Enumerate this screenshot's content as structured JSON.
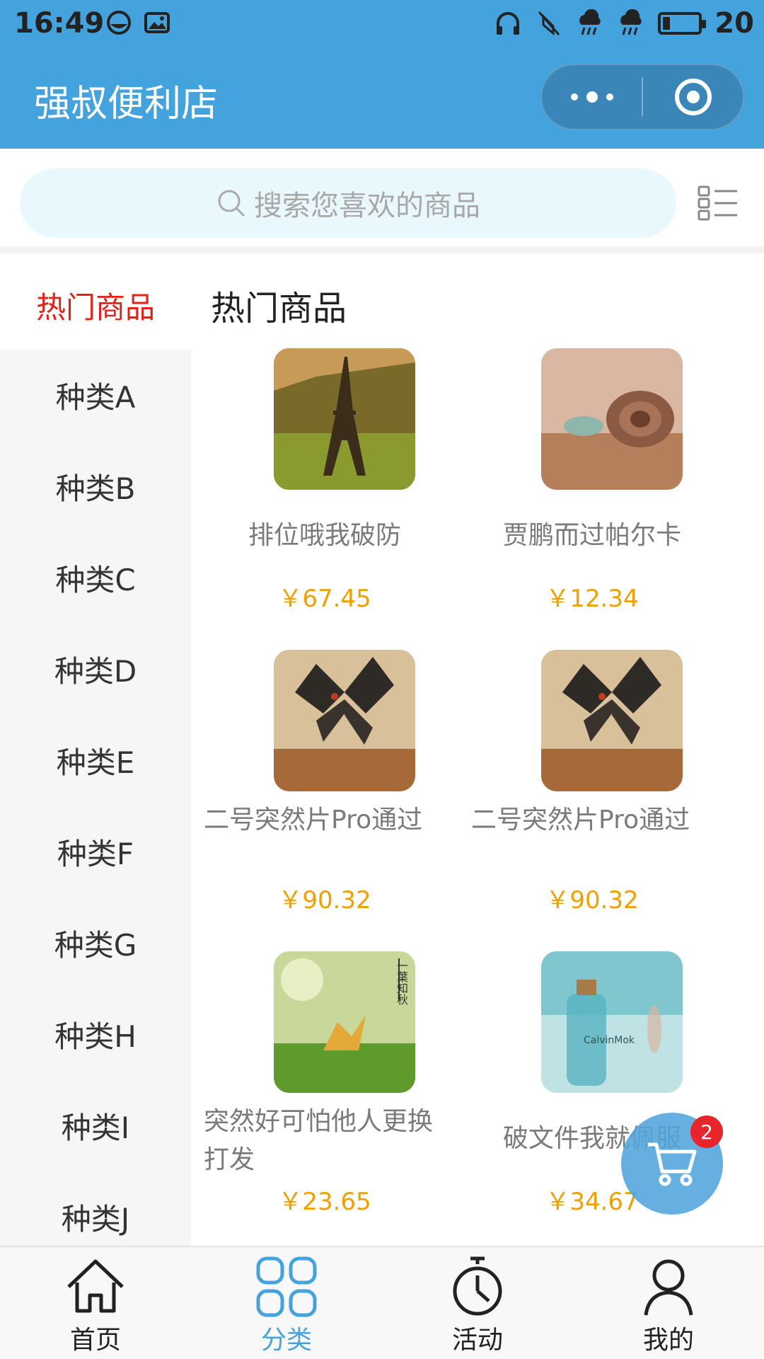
{
  "status_bar": {
    "time": "16:49",
    "battery_text": "20",
    "network": "4G"
  },
  "nav": {
    "title": "强叔便利店"
  },
  "search": {
    "placeholder": "搜索您喜欢的商品"
  },
  "sidebar": {
    "active": "热门商品",
    "items": [
      "种类A",
      "种类B",
      "种类C",
      "种类D",
      "种类E",
      "种类F",
      "种类G",
      "种类H",
      "种类I",
      "种类J"
    ]
  },
  "main": {
    "section_title": "热门商品",
    "products": [
      {
        "name": "排位哦我破防",
        "price": "￥67.45",
        "image": "eiffel-tower-photo"
      },
      {
        "name": "贾鹏而过帕尔卡",
        "price": "￥12.34",
        "image": "snail-shell-photo"
      },
      {
        "name": "二号突然片Pro通过",
        "price": "￥90.32",
        "image": "butterfly-photo"
      },
      {
        "name": "二号突然片Pro通过",
        "price": "￥90.32",
        "image": "butterfly-photo"
      },
      {
        "name": "突然好可怕他人更换打发",
        "price": "￥23.65",
        "image": "autumn-leaf-photo",
        "image_text": "一葉知秋"
      },
      {
        "name": "破文件我就佩服",
        "price": "￥34.67",
        "image": "message-bottle-photo",
        "image_text": "CalvinMok"
      }
    ]
  },
  "cart": {
    "badge_count": "2"
  },
  "tabbar": {
    "items": [
      {
        "label": "首页",
        "icon": "home-icon"
      },
      {
        "label": "分类",
        "icon": "category-icon"
      },
      {
        "label": "活动",
        "icon": "stopwatch-icon"
      },
      {
        "label": "我的",
        "icon": "user-icon"
      }
    ],
    "active_index": 1
  },
  "colors": {
    "header": "#44a2dc",
    "active_category": "#e2231a",
    "price": "#f0a000",
    "badge": "#e8252b"
  }
}
